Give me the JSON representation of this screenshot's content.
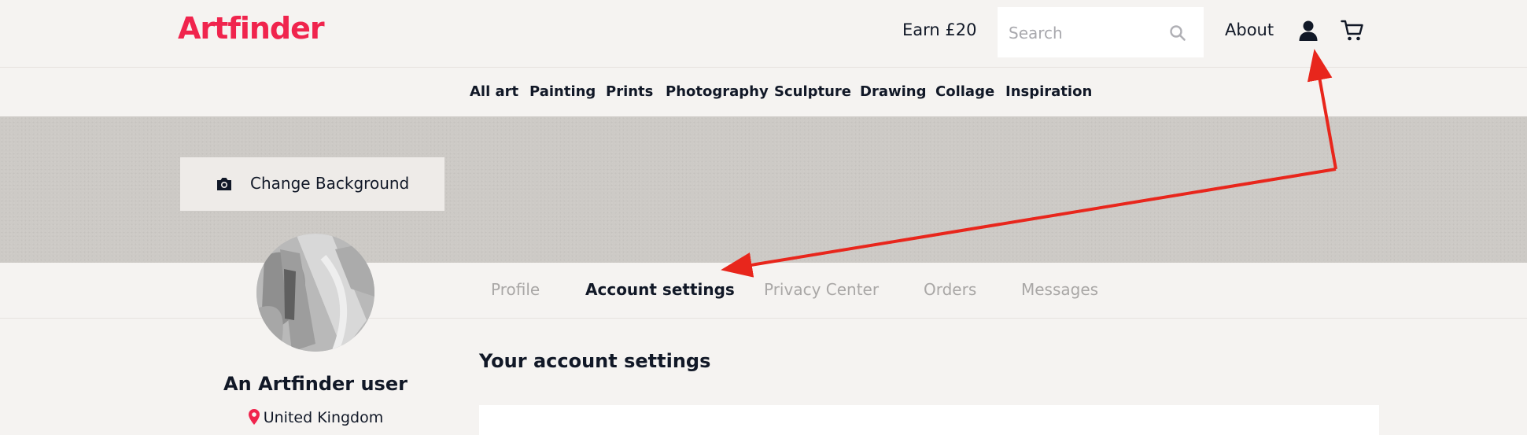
{
  "header": {
    "logo": "Artfinder",
    "earn_label": "Earn £20",
    "search": {
      "placeholder": "Search",
      "value": ""
    },
    "about_label": "About",
    "icons": [
      "search-icon",
      "user-icon",
      "cart-icon"
    ]
  },
  "categories": [
    "All art",
    "Painting",
    "Prints",
    "Photography",
    "Sculpture",
    "Drawing",
    "Collage",
    "Inspiration"
  ],
  "banner": {
    "change_background_label": "Change Background",
    "icon": "camera-icon"
  },
  "profile": {
    "name": "An Artfinder user",
    "location": "United Kingdom",
    "location_icon": "map-pin-icon"
  },
  "tabs": [
    {
      "label": "Profile",
      "active": false
    },
    {
      "label": "Account settings",
      "active": true
    },
    {
      "label": "Privacy Center",
      "active": false
    },
    {
      "label": "Orders",
      "active": false
    },
    {
      "label": "Messages",
      "active": false
    }
  ],
  "main": {
    "section_title": "Your account settings"
  },
  "colors": {
    "brand": "#f0244d",
    "annotation": "#e8261c",
    "text": "#111827",
    "muted_tab": "#a9a7a6"
  }
}
